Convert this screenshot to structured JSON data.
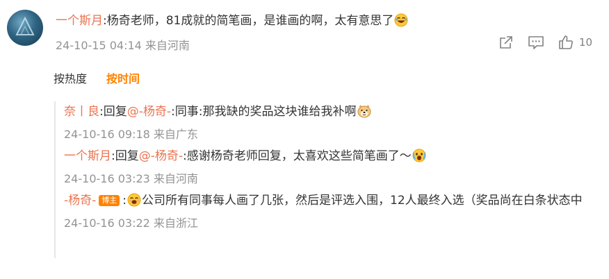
{
  "comment": {
    "username": "一个斯月",
    "text": ":杨奇老师，81成就的简笔画，是谁画的啊，太有意思了",
    "timestamp": "24-10-15 04:14",
    "location": "来自河南",
    "like_count": "10"
  },
  "sort": {
    "by_hot": "按热度",
    "by_time": "按时间"
  },
  "replies": [
    {
      "username": "奈丨良",
      "reply_prefix": ":回复",
      "mention": "@-杨奇-",
      "text": ":同事:那我缺的奖品这块谁给我补啊",
      "timestamp": "24-10-16 09:18",
      "location": "来自广东"
    },
    {
      "username": "一个斯月",
      "reply_prefix": ":回复",
      "mention": "@-杨奇-",
      "text": ":感谢杨奇老师回复，太喜欢这些简笔画了～",
      "timestamp": "24-10-16 03:23",
      "location": "来自河南"
    },
    {
      "username": "-杨奇-",
      "badge": "博主",
      "prefix": ":",
      "text": "公司所有同事每人画了几张，然后是评选入围，12人最终入选（奖品尚在白条状态中",
      "timestamp": "24-10-16 03:22",
      "location": "来自浙江"
    }
  ],
  "icons": {
    "share": "share-icon",
    "comment": "comment-icon",
    "like": "thumbs-up-icon",
    "laugh_emoji": "laugh-emoji-icon",
    "doge_emoji": "doge-emoji-icon",
    "scream_emoji": "scream-emoji-icon",
    "smile_emoji": "smile-emoji-icon"
  },
  "colors": {
    "username": "#eb7350",
    "active_tab": "#ff8200",
    "meta": "#939393"
  }
}
